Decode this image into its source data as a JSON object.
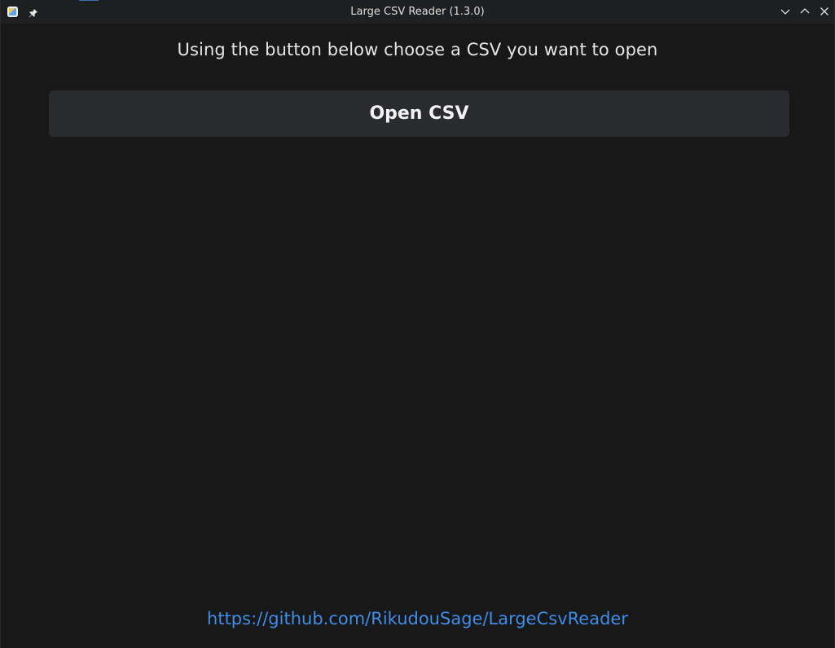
{
  "window": {
    "title": "Large CSV Reader (1.3.0)",
    "icons": {
      "app": "app-icon",
      "pin": "pin-icon",
      "minimize": "chevron-down-icon",
      "maximize": "chevron-up-icon",
      "close": "close-icon"
    }
  },
  "main": {
    "prompt": "Using the button below choose a CSV you want to open",
    "open_button_label": "Open CSV"
  },
  "footer": {
    "repo_link": "https://github.com/RikudouSage/LargeCsvReader"
  },
  "colors": {
    "background": "#181819",
    "titlebar": "#1e1f21",
    "button": "#2a2b2f",
    "link": "#3f8de8"
  }
}
